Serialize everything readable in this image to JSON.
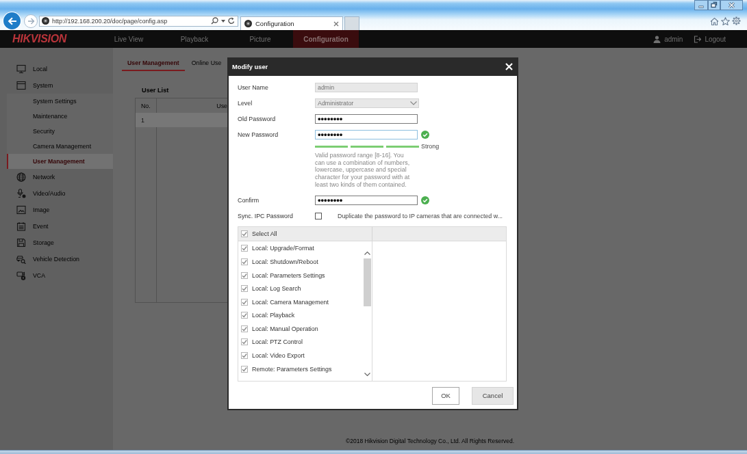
{
  "browser": {
    "address": "http://192.168.200.20/doc/page/config.asp",
    "tab": "Configuration"
  },
  "top_nav": {
    "logo": "HIKVISION",
    "items": [
      {
        "label": "Live View",
        "selected": false
      },
      {
        "label": "Playback",
        "selected": false
      },
      {
        "label": "Picture",
        "selected": false
      },
      {
        "label": "Configuration",
        "selected": true
      }
    ],
    "user": "admin",
    "logout": "Logout"
  },
  "sidebar": {
    "items": [
      {
        "label": "Local",
        "selected": false
      },
      {
        "label": "System",
        "selected": false,
        "children": [
          {
            "label": "System Settings",
            "selected": false
          },
          {
            "label": "Maintenance",
            "selected": false
          },
          {
            "label": "Security",
            "selected": false
          },
          {
            "label": "Camera Management",
            "selected": false
          },
          {
            "label": "User Management",
            "selected": true
          }
        ]
      },
      {
        "label": "Network",
        "selected": false
      },
      {
        "label": "Video/Audio",
        "selected": false
      },
      {
        "label": "Image",
        "selected": false
      },
      {
        "label": "Event",
        "selected": false
      },
      {
        "label": "Storage",
        "selected": false
      },
      {
        "label": "Vehicle Detection",
        "selected": false
      },
      {
        "label": "VCA",
        "selected": false
      }
    ]
  },
  "content": {
    "tabs": [
      {
        "label": "User Management",
        "selected": true
      },
      {
        "label": "Online Use",
        "selected": false
      }
    ],
    "user_list": {
      "title": "User List",
      "columns": [
        "No.",
        "Use"
      ],
      "rows": [
        {
          "cells": [
            "1"
          ],
          "selected": true
        }
      ]
    },
    "copyright": "©2018 Hikvision Digital Technology Co., Ltd. All Rights Reserved."
  },
  "dialog": {
    "title": "Modify user",
    "fields": [
      {
        "kind": "text",
        "label": "User Name",
        "value": "admin",
        "disabled": true,
        "focused": false,
        "valid": false
      },
      {
        "kind": "select",
        "label": "Level",
        "value": "Administrator",
        "disabled": true,
        "focused": false,
        "valid": false
      },
      {
        "kind": "password",
        "label": "Old Password",
        "value": "••••••••",
        "disabled": false,
        "focused": false,
        "valid": false
      },
      {
        "kind": "password",
        "label": "New Password",
        "value": "••••••••",
        "disabled": false,
        "focused": true,
        "valid": true,
        "strength": {
          "level": 1,
          "label": "Strong"
        },
        "hint": "Valid password range [8-16]. You can use a combination of numbers, lowercase, uppercase and special character for your password with at least two kinds of them contained."
      },
      {
        "kind": "password",
        "label": "Confirm",
        "value": "••••••••",
        "disabled": false,
        "focused": false,
        "valid": true
      },
      {
        "kind": "checkbox",
        "label": "Sync. IPC Password",
        "checked": false,
        "text": "Duplicate the password to IP cameras that are connected w..."
      }
    ],
    "permissions": {
      "select_all": {
        "label": "Select All",
        "checked": true
      },
      "items": [
        {
          "label": "Local: Upgrade/Format",
          "checked": true
        },
        {
          "label": "Local: Shutdown/Reboot",
          "checked": true
        },
        {
          "label": "Local: Parameters Settings",
          "checked": true
        },
        {
          "label": "Local: Log Search",
          "checked": true
        },
        {
          "label": "Local: Camera Management",
          "checked": true
        },
        {
          "label": "Local: Playback",
          "checked": true
        },
        {
          "label": "Local: Manual Operation",
          "checked": true
        },
        {
          "label": "Local: PTZ Control",
          "checked": true
        },
        {
          "label": "Local: Video Export",
          "checked": true
        },
        {
          "label": "Remote: Parameters Settings",
          "checked": true
        }
      ]
    },
    "buttons": [
      {
        "label": "OK",
        "kind": "primary"
      },
      {
        "label": "Cancel",
        "kind": "secondary"
      }
    ]
  }
}
